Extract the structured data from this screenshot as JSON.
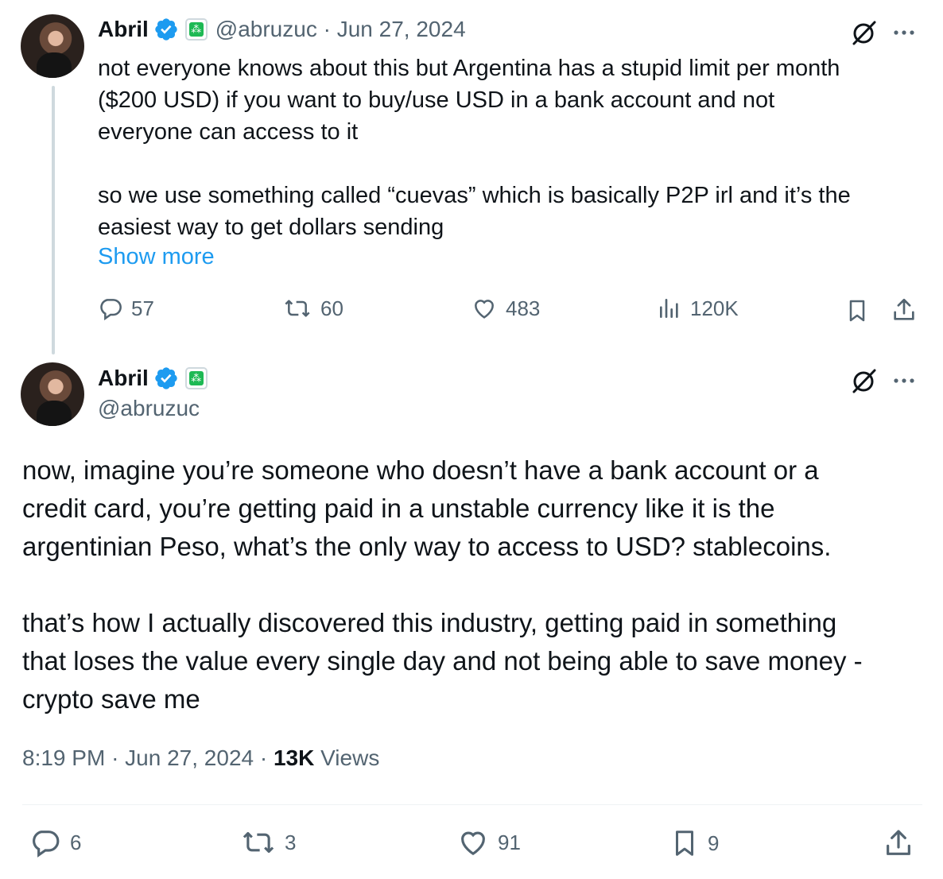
{
  "tweet1": {
    "display_name": "Abril",
    "handle": "@abruzuc",
    "date": "Jun 27, 2024",
    "lines": [
      "not everyone knows about this but Argentina has a stupid limit per month",
      "($200 USD) if you want to buy/use USD in a bank account and not",
      "everyone can access to it",
      "",
      "so we use something called “cuevas” which is basically P2P irl and it’s the",
      "easiest way to get dollars sending"
    ],
    "show_more": "Show more",
    "replies": "57",
    "reposts": "60",
    "likes": "483",
    "views": "120K"
  },
  "tweet2": {
    "display_name": "Abril",
    "handle": "@abruzuc",
    "lines": [
      "now, imagine you’re someone who doesn’t have a bank account or a",
      "credit card, you’re getting paid in a unstable currency like it is the",
      "argentinian Peso, what’s the only way to access to USD? stablecoins.",
      "",
      "that’s how I actually discovered this industry, getting paid in something",
      "that loses the value every single day and not being able to save money -",
      "crypto save me"
    ],
    "time": "8:19 PM",
    "date": "Jun 27, 2024",
    "views_count": "13K",
    "views_label": "Views",
    "replies": "6",
    "reposts": "3",
    "likes": "91",
    "bookmarks": "9"
  },
  "colors": {
    "text": "#0f1419",
    "muted": "#536471",
    "link": "#1d9bf0",
    "verified": "#1d9bf0",
    "affiliate": "#1db954",
    "thread_line": "#cfd9de"
  },
  "icons": {
    "verified": "verified-badge-icon",
    "affiliate": "affiliate-badge-icon",
    "grok": "grok-icon",
    "more": "more-icon",
    "reply": "reply-icon",
    "repost": "repost-icon",
    "like": "heart-icon",
    "views": "views-icon",
    "bookmark": "bookmark-icon",
    "share": "share-icon"
  }
}
